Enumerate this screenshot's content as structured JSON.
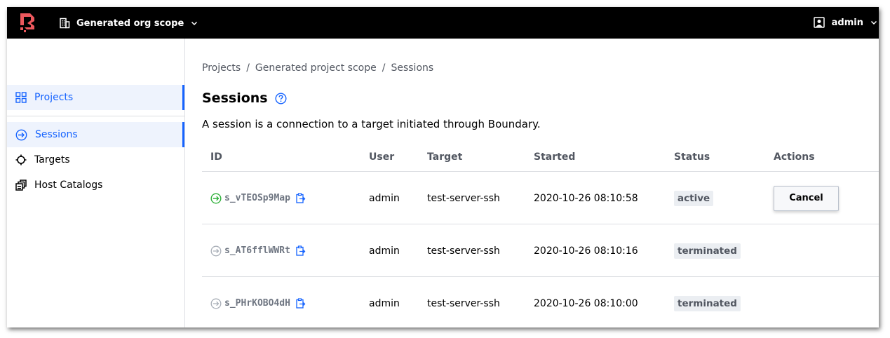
{
  "topbar": {
    "scope_label": "Generated org scope",
    "user_label": "admin"
  },
  "colors": {
    "accent": "#1563ff",
    "active_session": "#2eb039",
    "topbar": "#000000"
  },
  "sidebar": {
    "items": [
      {
        "label": "Projects",
        "icon": "grid-icon"
      },
      {
        "label": "Sessions",
        "icon": "session-arrow-icon"
      },
      {
        "label": "Targets",
        "icon": "crosshair-icon"
      },
      {
        "label": "Host Catalogs",
        "icon": "host-catalog-icon"
      }
    ]
  },
  "breadcrumb": [
    "Projects",
    "Generated project scope",
    "Sessions"
  ],
  "breadcrumb_sep": "/",
  "page": {
    "title": "Sessions",
    "description": "A session is a connection to a target initiated through Boundary."
  },
  "table": {
    "headers": [
      "ID",
      "User",
      "Target",
      "Started",
      "Status",
      "Actions"
    ],
    "rows": [
      {
        "id": "s_vTEOSp9Map",
        "user": "admin",
        "target": "test-server-ssh",
        "started": "2020-10-26 08:10:58",
        "status": "active",
        "action": "Cancel"
      },
      {
        "id": "s_AT6fflWWRt",
        "user": "admin",
        "target": "test-server-ssh",
        "started": "2020-10-26 08:10:16",
        "status": "terminated",
        "action": ""
      },
      {
        "id": "s_PHrKOBO4dH",
        "user": "admin",
        "target": "test-server-ssh",
        "started": "2020-10-26 08:10:00",
        "status": "terminated",
        "action": ""
      }
    ]
  }
}
